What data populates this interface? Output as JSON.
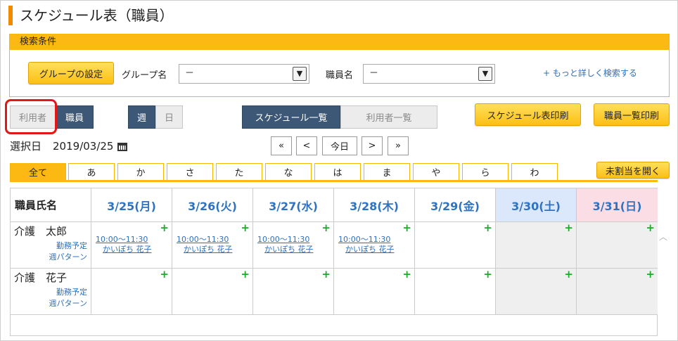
{
  "page": {
    "title": "スケジュール表（職員）"
  },
  "search": {
    "header": "検索条件",
    "group_settings_button": "グループの設定",
    "group_name_label": "グループ名",
    "group_name_value": "－",
    "staff_name_label": "職員名",
    "staff_name_value": "－",
    "advanced_search_link": "+ もっと詳しく検索する"
  },
  "view_toggles": {
    "user": "利用者",
    "staff": "職員",
    "week": "週",
    "day": "日",
    "schedule_list": "スケジュール一覧",
    "user_list": "利用者一覧"
  },
  "print_buttons": {
    "schedule_print": "スケジュール表印刷",
    "staff_list_print": "職員一覧印刷"
  },
  "date": {
    "label": "選択日",
    "value": "2019/03/25"
  },
  "nav": {
    "first": "«",
    "prev": "<",
    "today": "今日",
    "next": ">",
    "last": "»"
  },
  "kana_tabs": [
    "全て",
    "あ",
    "か",
    "さ",
    "た",
    "な",
    "は",
    "ま",
    "や",
    "ら",
    "わ"
  ],
  "unassigned_button": "未割当を開く",
  "grid": {
    "name_header": "職員氏名",
    "days": [
      "3/25(月)",
      "3/26(火)",
      "3/27(水)",
      "3/28(木)",
      "3/29(金)",
      "3/30(土)",
      "3/31(日)"
    ],
    "plus": "+",
    "rows": [
      {
        "name": "介護　太郎",
        "link_planned": "勤務予定",
        "link_pattern": "週パターン",
        "events": [
          {
            "time": "10:00～11:30",
            "who": "かいぽち 花子"
          },
          {
            "time": "10:00～11:30",
            "who": "かいぽち 花子"
          },
          {
            "time": "10:00～11:30",
            "who": "かいぽち 花子"
          },
          {
            "time": "10:00～11:30",
            "who": "かいぽち 花子"
          }
        ]
      },
      {
        "name": "介護　花子",
        "link_planned": "勤務予定",
        "link_pattern": "週パターン",
        "events": []
      }
    ]
  },
  "colors": {
    "accent": "#fdb913",
    "title_bar": "#f08a00",
    "dark_toggle": "#3d5876",
    "link": "#2f6fb8",
    "plus": "#1aab2a",
    "saturday": "#dbe8fb",
    "sunday": "#fbdde6",
    "highlight": "#e01818"
  }
}
